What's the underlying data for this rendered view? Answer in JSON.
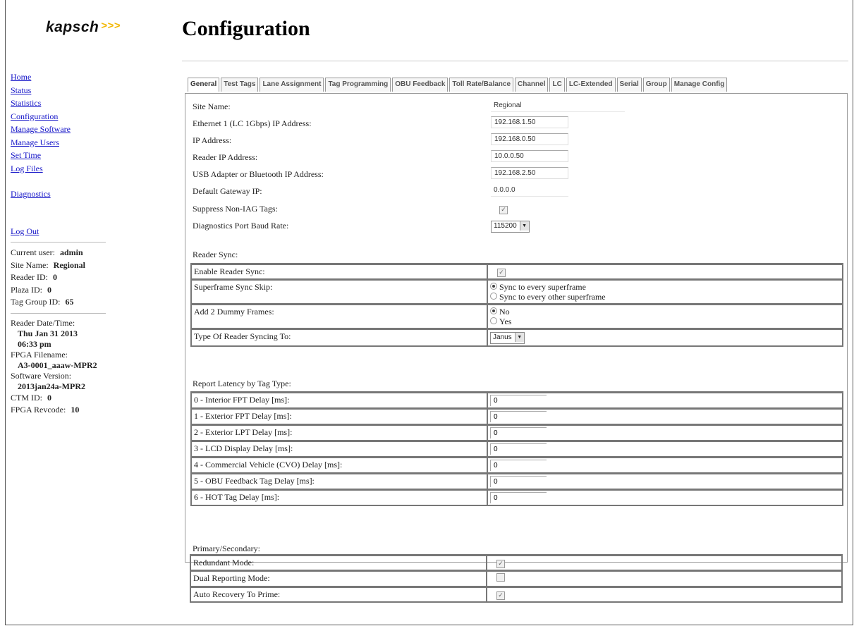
{
  "header": {
    "logo": "kapsch",
    "logo_arrows": ">>>",
    "title": "Configuration"
  },
  "sidebar": {
    "links": [
      "Home",
      "Status",
      "Statistics",
      "Configuration",
      "Manage Software",
      "Manage Users",
      "Set Time",
      "Log Files"
    ],
    "diagnostics": "Diagnostics",
    "logout": "Log Out",
    "info": {
      "current_user_label": "Current user:",
      "current_user": "admin",
      "site_name_label": "Site Name:",
      "site_name": "Regional",
      "reader_id_label": "Reader ID:",
      "reader_id": "0",
      "plaza_id_label": "Plaza ID:",
      "plaza_id": "0",
      "tag_group_label": "Tag Group ID:",
      "tag_group": "65",
      "reader_dt_label": "Reader Date/Time:",
      "reader_date": "Thu Jan 31 2013",
      "reader_time": "06:33 pm",
      "fpga_file_label": "FPGA Filename:",
      "fpga_file": "A3-0001_aaaw-MPR2",
      "sw_version_label": "Software Version:",
      "sw_version": "2013jan24a-MPR2",
      "ctm_id_label": "CTM ID:",
      "ctm_id": "0",
      "fpga_rev_label": "FPGA Revcode:",
      "fpga_rev": "10"
    }
  },
  "tabs": [
    "General",
    "Test Tags",
    "Lane Assignment",
    "Tag Programming",
    "OBU Feedback",
    "Toll Rate/Balance",
    "Channel",
    "LC",
    "LC-Extended",
    "Serial",
    "Group",
    "Manage Config"
  ],
  "general": {
    "site_name_label": "Site Name:",
    "site_name": "Regional",
    "eth1_label": "Ethernet 1 (LC 1Gbps) IP Address:",
    "eth1": "192.168.1.50",
    "ip_label": "IP Address:",
    "ip": "192.168.0.50",
    "reader_ip_label": "Reader IP Address:",
    "reader_ip": "10.0.0.50",
    "usb_label": "USB Adapter or Bluetooth IP Address:",
    "usb_ip": "192.168.2.50",
    "gateway_label": "Default Gateway IP:",
    "gateway": "0.0.0.0",
    "suppress_label": "Suppress Non-IAG Tags:",
    "baud_label": "Diagnostics Port Baud Rate:",
    "baud": "115200"
  },
  "reader_sync": {
    "section": "Reader Sync:",
    "enable_label": "Enable Reader Sync:",
    "skip_label": "Superframe Sync Skip:",
    "skip_opt1": "Sync to every superframe",
    "skip_opt2": "Sync to every other superframe",
    "dummy_label": "Add 2 Dummy Frames:",
    "dummy_no": "No",
    "dummy_yes": "Yes",
    "type_label": "Type Of Reader Syncing To:",
    "type_value": "Janus"
  },
  "latency": {
    "section": "Report Latency by Tag Type:",
    "rows": [
      {
        "label": "0 - Interior FPT Delay [ms]:",
        "value": "0"
      },
      {
        "label": "1 - Exterior FPT Delay [ms]:",
        "value": "0"
      },
      {
        "label": "2 - Exterior LPT Delay [ms]:",
        "value": "0"
      },
      {
        "label": "3 - LCD Display Delay [ms]:",
        "value": "0"
      },
      {
        "label": "4 - Commercial Vehicle (CVO) Delay [ms]:",
        "value": "0"
      },
      {
        "label": "5 - OBU Feedback Tag Delay [ms]:",
        "value": "0"
      },
      {
        "label": "6 - HOT Tag Delay [ms]:",
        "value": "0"
      }
    ]
  },
  "primary": {
    "section": "Primary/Secondary:",
    "redundant_label": "Redundant Mode:",
    "dual_label": "Dual Reporting Mode:",
    "auto_label": "Auto Recovery To Prime:"
  },
  "check_glyph": "✓"
}
